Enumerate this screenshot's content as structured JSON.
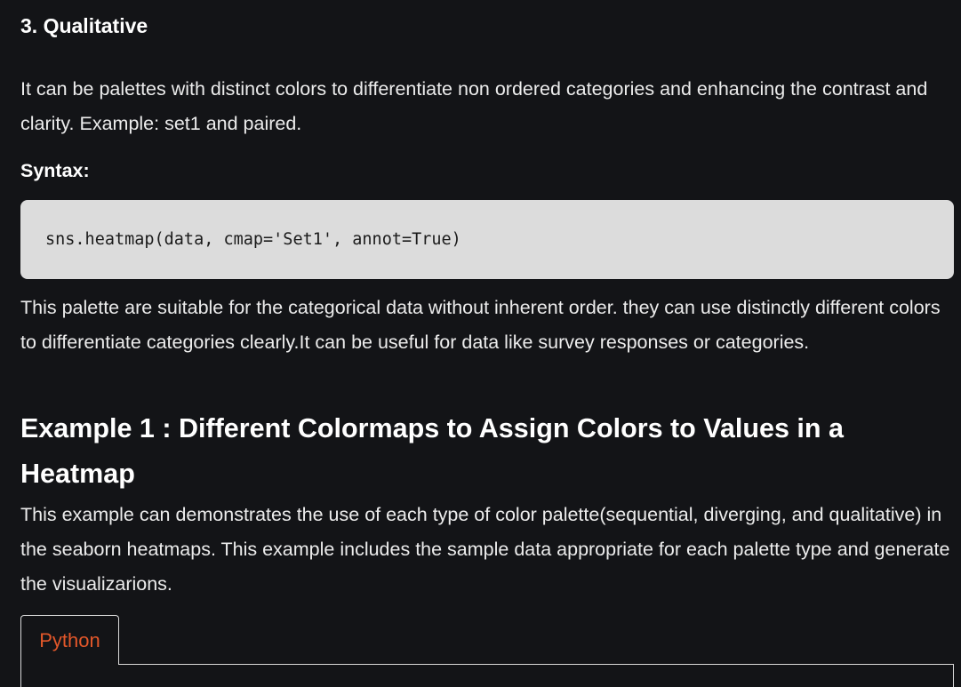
{
  "section": {
    "title": "3. Qualitative",
    "description": "It can be palettes with distinct colors to differentiate non ordered categories and enhancing the contrast and clarity. Example: set1 and paired.",
    "syntax_label": "Syntax:",
    "code": "sns.heatmap(data, cmap='Set1', annot=True)",
    "note": "This palette are suitable for the categorical data without inherent order. they can use distinctly different colors to differentiate categories clearly.It can be useful for data like survey responses or categories."
  },
  "example": {
    "title": "Example 1 : Different Colormaps to Assign Colors to Values in a Heatmap",
    "description": "This example can demonstrates the use of each type of color palette(sequential, diverging, and qualitative) in the seaborn heatmaps. This example includes the sample data appropriate for each palette type and generate the visualizarions."
  },
  "code_tabs": [
    {
      "label": "Python",
      "active": true
    }
  ],
  "colors": {
    "background": "#131417",
    "code_background": "#dcdcdc",
    "tab_accent": "#e2572a"
  }
}
